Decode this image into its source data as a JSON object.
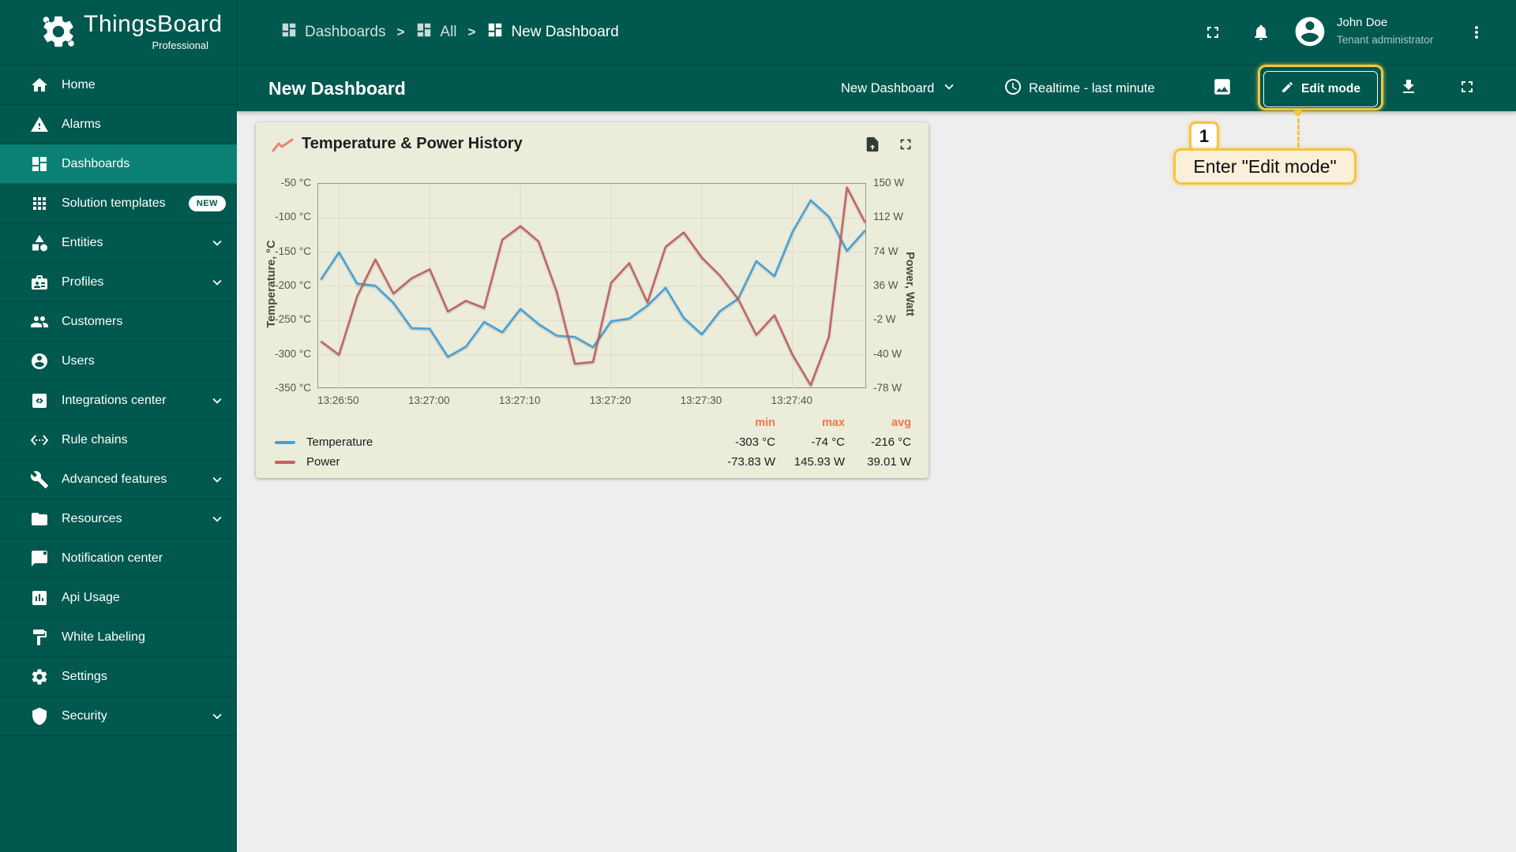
{
  "app": {
    "name": "ThingsBoard",
    "edition": "Professional"
  },
  "topbar": {
    "separator": ">",
    "breadcrumbs": [
      {
        "label": "Dashboards",
        "icon": "dashboards-icon"
      },
      {
        "label": "All",
        "icon": "dashboards-icon"
      },
      {
        "label": "New Dashboard",
        "icon": "dashboards-icon"
      }
    ],
    "user": {
      "name": "John Doe",
      "role": "Tenant administrator"
    }
  },
  "toolbar": {
    "title": "New Dashboard",
    "state_selector_label": "New Dashboard",
    "time_window_label": "Realtime - last minute",
    "edit_button_label": "Edit mode"
  },
  "sidebar": {
    "items": [
      {
        "label": "Home",
        "icon": "home-icon"
      },
      {
        "label": "Alarms",
        "icon": "alarm-icon"
      },
      {
        "label": "Dashboards",
        "icon": "dashboards-icon",
        "active": true
      },
      {
        "label": "Solution templates",
        "icon": "solution-templates-icon",
        "badge": "NEW"
      },
      {
        "label": "Entities",
        "icon": "entities-icon",
        "expandable": true
      },
      {
        "label": "Profiles",
        "icon": "profiles-icon",
        "expandable": true
      },
      {
        "label": "Customers",
        "icon": "customers-icon"
      },
      {
        "label": "Users",
        "icon": "users-icon"
      },
      {
        "label": "Integrations center",
        "icon": "integrations-icon",
        "expandable": true
      },
      {
        "label": "Rule chains",
        "icon": "rule-chains-icon"
      },
      {
        "label": "Advanced features",
        "icon": "advanced-features-icon",
        "expandable": true
      },
      {
        "label": "Resources",
        "icon": "resources-icon",
        "expandable": true
      },
      {
        "label": "Notification center",
        "icon": "notification-icon"
      },
      {
        "label": "Api Usage",
        "icon": "api-usage-icon"
      },
      {
        "label": "White Labeling",
        "icon": "white-labeling-icon"
      },
      {
        "label": "Settings",
        "icon": "settings-icon"
      },
      {
        "label": "Security",
        "icon": "security-icon",
        "expandable": true
      }
    ]
  },
  "widget": {
    "title": "Temperature & Power History"
  },
  "chart_data": {
    "type": "line",
    "title": "Temperature & Power History",
    "x_tick_labels": [
      "13:26:50",
      "13:27:00",
      "13:27:10",
      "13:27:20",
      "13:27:30",
      "13:27:40"
    ],
    "x_tick_seconds": [
      50,
      60,
      70,
      80,
      90,
      100
    ],
    "x_range_seconds": [
      47.7,
      108.2
    ],
    "sample_seconds": [
      48,
      50,
      52,
      54,
      56,
      58,
      60,
      62,
      64,
      66,
      68,
      70,
      72,
      74,
      76,
      78,
      80,
      82,
      84,
      86,
      88,
      90,
      92,
      94,
      96,
      98,
      100,
      102,
      104,
      106,
      108
    ],
    "left_axis": {
      "title": "Temperature, °C",
      "tick_labels": [
        "-50 °C",
        "-100 °C",
        "-150 °C",
        "-200 °C",
        "-250 °C",
        "-300 °C",
        "-350 °C"
      ],
      "range": [
        -350,
        -50
      ]
    },
    "right_axis": {
      "title": "Power, Watt",
      "tick_labels": [
        "150 W",
        "112 W",
        "74 W",
        "36 W",
        "-2 W",
        "-40 W",
        "-78 W"
      ],
      "range": [
        -78,
        150
      ]
    },
    "grid": true,
    "legend_position": "bottom",
    "legend_columns": [
      "min",
      "max",
      "avg"
    ],
    "series": [
      {
        "name": "Temperature",
        "unit": "°C",
        "axis": "left",
        "color": "#3fa2db",
        "values": [
          -190,
          -150,
          -196,
          -199,
          -224,
          -261,
          -262,
          -303,
          -288,
          -252,
          -267,
          -233,
          -255,
          -272,
          -274,
          -289,
          -251,
          -247,
          -228,
          -202,
          -246,
          -270,
          -236,
          -218,
          -163,
          -185,
          -120,
          -74,
          -98,
          -148,
          -118
        ],
        "stats": {
          "min": "-303 °C",
          "max": "-74 °C",
          "avg": "-216 °C"
        }
      },
      {
        "name": "Power",
        "unit": "W",
        "axis": "right",
        "color": "#c4625d",
        "values": [
          -25,
          -40,
          25,
          66,
          28,
          45,
          55,
          8,
          20,
          12,
          88,
          103,
          86,
          30,
          -50,
          -48,
          40,
          62,
          18,
          80,
          96,
          68,
          48,
          22,
          -18,
          4,
          -40,
          -74,
          -20,
          146,
          107
        ],
        "stats": {
          "min": "-73.83 W",
          "max": "145.93 W",
          "avg": "39.01 W"
        }
      }
    ]
  },
  "annotation": {
    "step": "1",
    "text": "Enter \"Edit mode\"",
    "color": "#f4c542"
  },
  "colors": {
    "primary_green": "#00584e",
    "active_item": "#0b8174",
    "content_bg": "#eeeeee",
    "card_bg": "#ececdb",
    "grid_line": "#dcdccb",
    "plot_border": "#97978c",
    "temperature_line": "#3fa2db",
    "power_line": "#c4625d",
    "legend_header": "#f3764c",
    "annotation_yellow": "#f4c542"
  }
}
